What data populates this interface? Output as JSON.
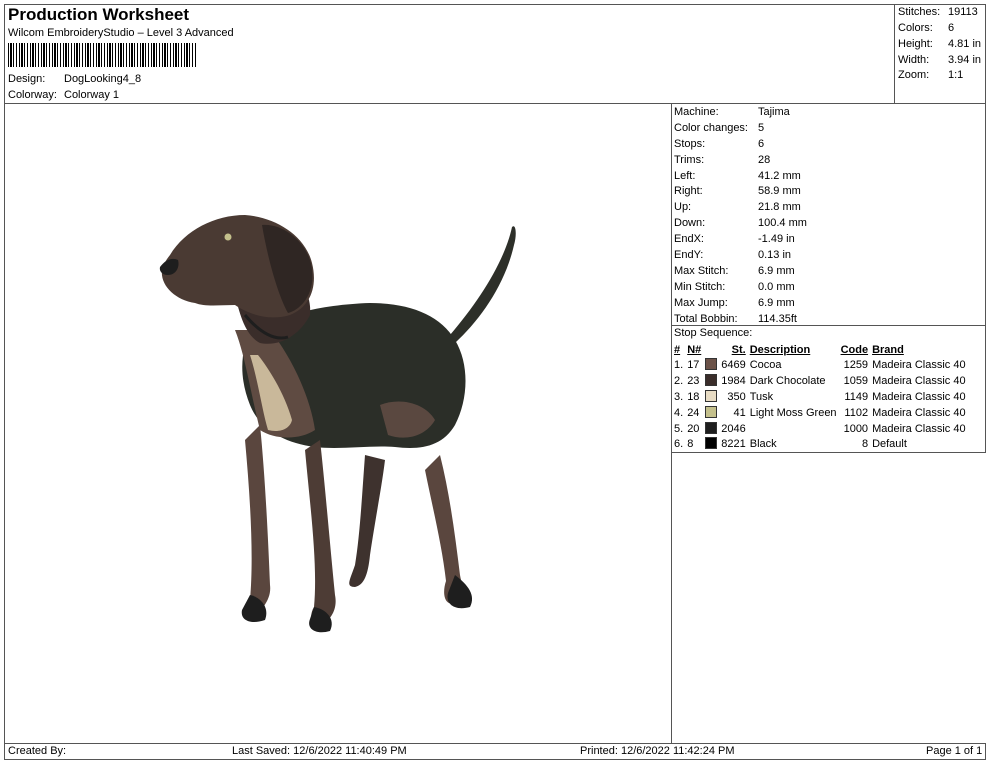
{
  "header": {
    "title": "Production Worksheet",
    "software": "Wilcom EmbroideryStudio – Level 3 Advanced",
    "design_label": "Design:",
    "design_value": "DogLooking4_8",
    "colorway_label": "Colorway:",
    "colorway_value": "Colorway 1"
  },
  "stats": {
    "stitches_label": "Stitches:",
    "stitches": "19113",
    "colors_label": "Colors:",
    "colors": "6",
    "height_label": "Height:",
    "height": "4.81 in",
    "width_label": "Width:",
    "width": "3.94 in",
    "zoom_label": "Zoom:",
    "zoom": "1:1"
  },
  "machine_info": [
    {
      "label": "Machine:",
      "value": "Tajima"
    },
    {
      "label": "Color changes:",
      "value": "5"
    },
    {
      "label": "Stops:",
      "value": "6"
    },
    {
      "label": "Trims:",
      "value": "28"
    },
    {
      "label": "Left:",
      "value": "41.2 mm"
    },
    {
      "label": "Right:",
      "value": "58.9 mm"
    },
    {
      "label": "Up:",
      "value": "21.8 mm"
    },
    {
      "label": "Down:",
      "value": "100.4 mm"
    },
    {
      "label": "EndX:",
      "value": "-1.49 in"
    },
    {
      "label": "EndY:",
      "value": "0.13 in"
    },
    {
      "label": "Max Stitch:",
      "value": "6.9 mm"
    },
    {
      "label": "Min Stitch:",
      "value": "0.0 mm"
    },
    {
      "label": "Max Jump:",
      "value": "6.9 mm"
    },
    {
      "label": "Total Bobbin:",
      "value": "114.35ft"
    }
  ],
  "stop_sequence": {
    "title": "Stop Sequence:",
    "headers": {
      "num": "#",
      "n": "N#",
      "st": "St.",
      "description": "Description",
      "code": "Code",
      "brand": "Brand"
    },
    "rows": [
      {
        "num": "1.",
        "n": "17",
        "color": "#6b5248",
        "st": "6469",
        "description": "Cocoa",
        "code": "1259",
        "brand": "Madeira Classic 40"
      },
      {
        "num": "2.",
        "n": "23",
        "color": "#3a2d2a",
        "st": "1984",
        "description": "Dark Chocolate",
        "code": "1059",
        "brand": "Madeira Classic 40"
      },
      {
        "num": "3.",
        "n": "18",
        "color": "#e8dcc4",
        "st": "350",
        "description": "Tusk",
        "code": "1149",
        "brand": "Madeira Classic 40"
      },
      {
        "num": "4.",
        "n": "24",
        "color": "#c4c08c",
        "st": "41",
        "description": "Light Moss Green",
        "code": "1102",
        "brand": "Madeira Classic 40"
      },
      {
        "num": "5.",
        "n": "20",
        "color": "#1e1e1e",
        "st": "2046",
        "description": "",
        "code": "1000",
        "brand": "Madeira Classic 40"
      },
      {
        "num": "6.",
        "n": "8",
        "color": "#000000",
        "st": "8221",
        "description": "Black",
        "code": "8",
        "brand": "Default"
      }
    ]
  },
  "footer": {
    "created_by": "Created By:",
    "last_saved": "Last Saved: 12/6/2022 11:40:49 PM",
    "printed": "Printed: 12/6/2022 11:42:24 PM",
    "page": "Page 1 of 1"
  }
}
